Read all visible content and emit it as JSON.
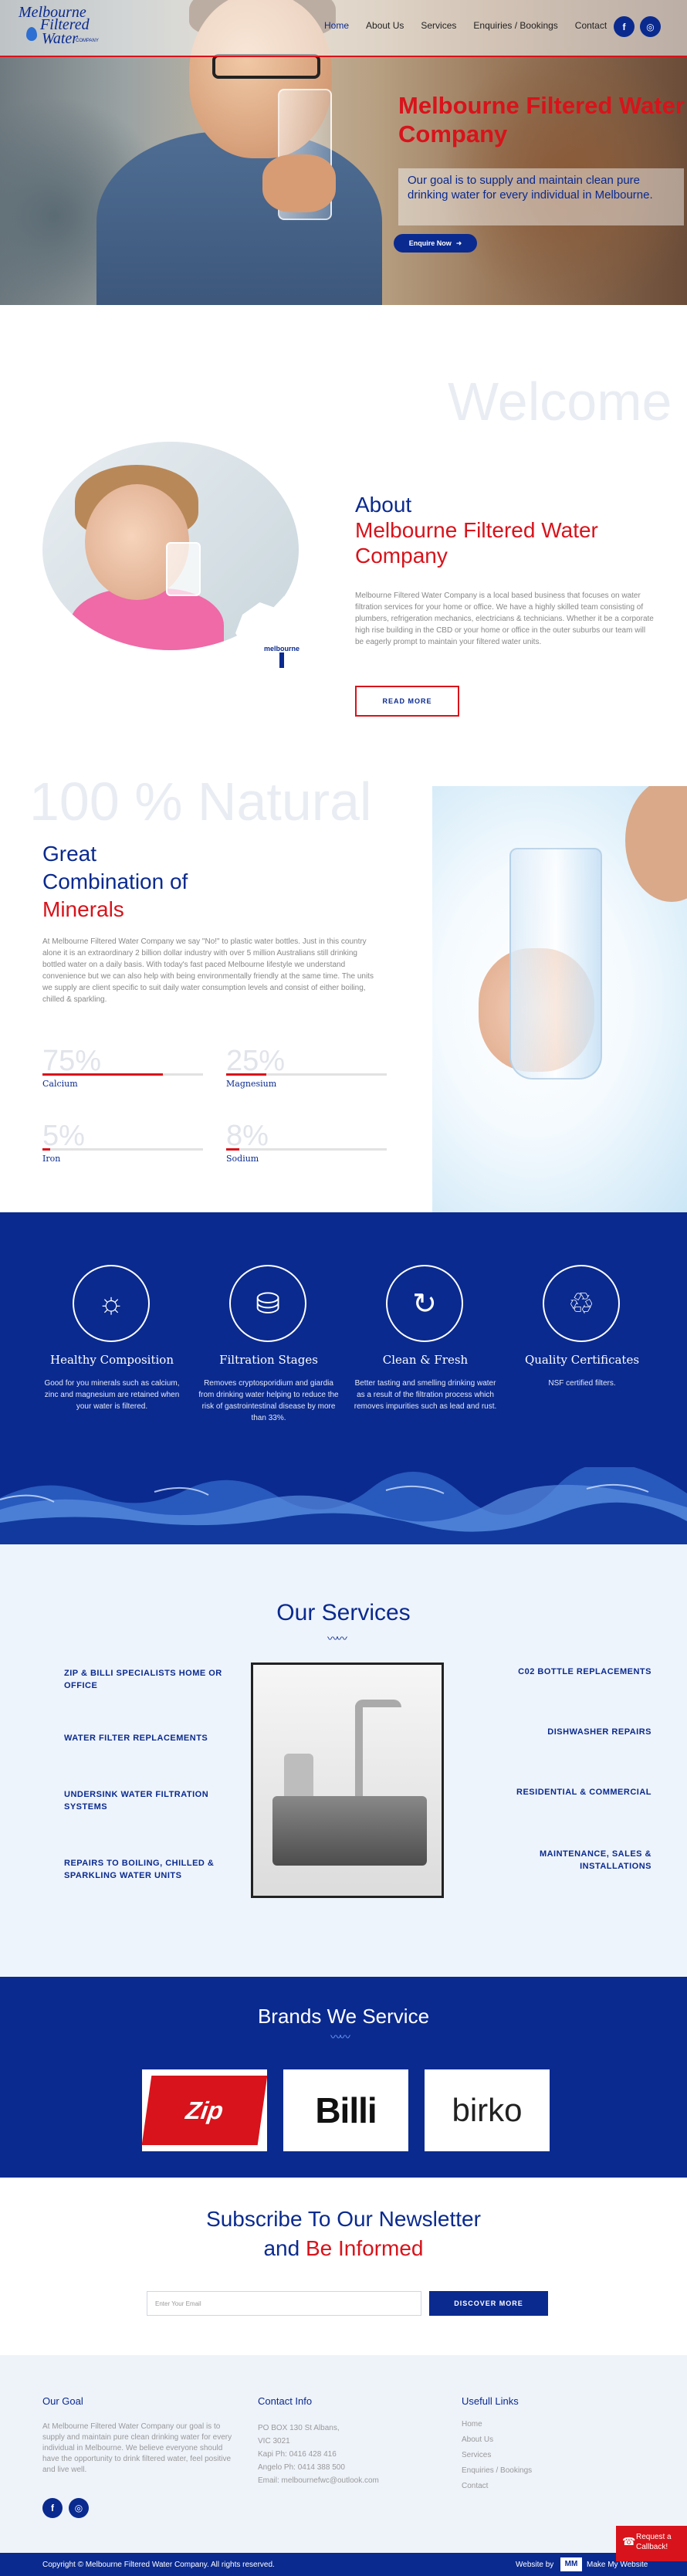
{
  "header": {
    "logo": {
      "line1": "Melbourne",
      "line2": "Filtered",
      "line3": "Water",
      "tagline": "COMPANY"
    },
    "nav": [
      "Home",
      "About Us",
      "Services",
      "Enquiries / Bookings",
      "Contact"
    ],
    "social": {
      "facebook": "f",
      "instagram": "◎"
    }
  },
  "hero": {
    "title": "Melbourne Filtered Water Company",
    "subtitle": "Our goal is to supply and maintain clean pure drinking water for every individual in Melbourne.",
    "cta": "Enquire Now"
  },
  "about": {
    "bg_word": "Welcome",
    "heading_top": "About",
    "heading_accent": "Melbourne Filtered Water Company",
    "map_label": "melbourne",
    "body": "Melbourne Filtered Water Company is a local based business that focuses on water filtration services for your home or office. We have a highly skilled team consisting of plumbers, refrigeration mechanics, electricians & technicians. Whether it be a corporate high rise building in the CBD or your home or office in the outer suburbs our team will be eagerly prompt to maintain your filtered water units.",
    "button": "READ MORE"
  },
  "minerals": {
    "bg_word": "100 % Natural",
    "heading_1": "Great",
    "heading_2": "Combination of",
    "heading_accent": "Minerals",
    "body": "At Melbourne Filtered Water Company we say \"No!\" to plastic water bottles. Just in this country alone it is an extraordinary 2 billion dollar industry with over 5 million Australians still drinking bottled water on a daily basis. With today's fast paced Melbourne lifestyle we understand convenience but we can also help with being environmentally friendly at the same time. The units we supply are client specific to suit daily water consumption levels and consist of either boiling, chilled & sparkling.",
    "bars": [
      {
        "label": "75%",
        "name": "Calcium",
        "value": 75
      },
      {
        "label": "25%",
        "name": "Magnesium",
        "value": 25
      },
      {
        "label": "5%",
        "name": "Iron",
        "value": 5
      },
      {
        "label": "8%",
        "name": "Sodium",
        "value": 8
      }
    ]
  },
  "features": [
    {
      "icon": "sun-water-icon",
      "glyph": "☼",
      "title": "Healthy Composition",
      "desc": "Good for you minerals such as calcium, zinc and magnesium are retained when your water is filtered."
    },
    {
      "icon": "bottle-icon",
      "glyph": "⛁",
      "title": "Filtration Stages",
      "desc": "Removes cryptosporidium and giardia from drinking water helping to reduce the risk of gastrointestinal disease by more than 33%."
    },
    {
      "icon": "drop-refresh-icon",
      "glyph": "↻",
      "title": "Clean & Fresh",
      "desc": "Better tasting and smelling drinking water as a result of the filtration process which removes impurities such as lead and rust."
    },
    {
      "icon": "recycle-icon",
      "glyph": "♲",
      "title": "Quality Certificates",
      "desc": "NSF certified filters."
    }
  ],
  "services": {
    "heading": "Our Services",
    "left": [
      "ZIP & BILLI SPECIALISTS HOME OR OFFICE",
      "WATER FILTER REPLACEMENTS",
      "UNDERSINK WATER FILTRATION SYSTEMS",
      "REPAIRS TO BOILING, CHILLED & SPARKLING WATER UNITS"
    ],
    "right": [
      "C02 BOTTLE REPLACEMENTS",
      "DISHWASHER REPAIRS",
      "RESIDENTIAL & COMMERCIAL",
      "MAINTENANCE, SALES & INSTALLATIONS"
    ]
  },
  "brands": {
    "heading": "Brands We Service",
    "items": [
      "Zip",
      "Billi",
      "birko"
    ]
  },
  "newsletter": {
    "heading_1": "Subscribe To Our Newsletter",
    "heading_2a": "and",
    "heading_2b": "Be Informed",
    "placeholder": "Enter Your Email",
    "button": "DISCOVER MORE"
  },
  "footer": {
    "goal_heading": "Our Goal",
    "goal_text": "At Melbourne Filtered Water Company our goal is to supply and maintain pure clean drinking water for every individual in Melbourne. We believe everyone should have the opportunity to drink filtered water, feel positive and live well.",
    "contact_heading": "Contact Info",
    "contact_lines": [
      "PO BOX 130 St Albans,",
      "VIC 3021",
      "Kapi Ph: 0416 428 416",
      "Angelo Ph: 0414 388 500",
      "Email: melbournefwc@outlook.com"
    ],
    "links_heading": "Usefull Links",
    "links": [
      "Home",
      "About Us",
      "Services",
      "Enquiries / Bookings",
      "Contact"
    ],
    "copyright": "Copyright © Melbourne Filtered Water Company. All rights reserved.",
    "credit_prefix": "Website by",
    "credit_name": "Make My Website",
    "callback_1": "Request a",
    "callback_2": "Callback!"
  }
}
